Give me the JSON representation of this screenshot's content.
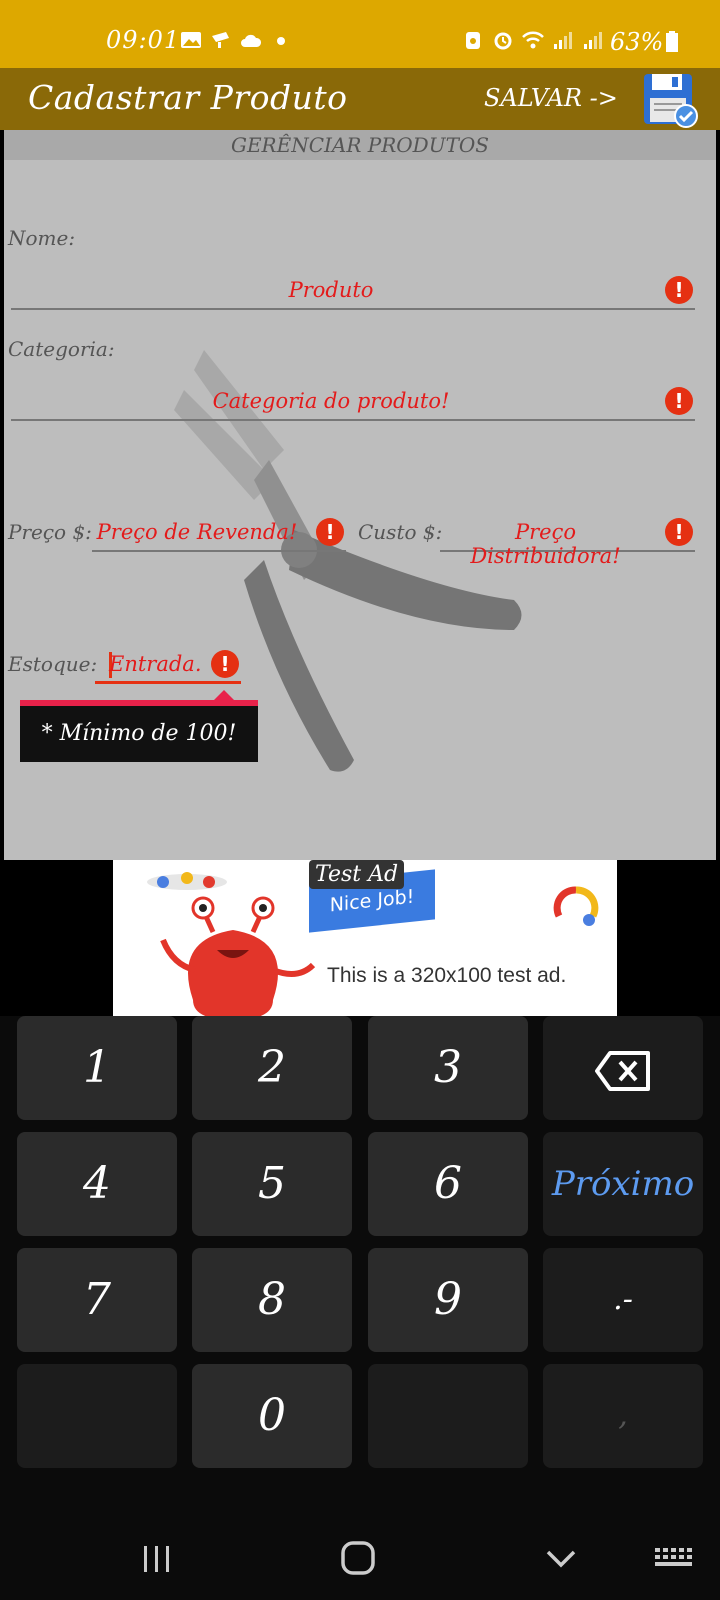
{
  "status_bar": {
    "time": "09:01",
    "battery": "63%"
  },
  "app_bar": {
    "title": "Cadastrar Produto",
    "save_label": "SALVAR ->"
  },
  "section": {
    "header": "GERÊNCIAR PRODUTOS"
  },
  "form": {
    "nome_label": "Nome:",
    "nome_placeholder": "Produto",
    "categoria_label": "Categoria:",
    "categoria_placeholder": "Categoria do produto!",
    "preco_label": "Preço $:",
    "preco_placeholder": "Preço de Revenda!",
    "custo_label": "Custo $:",
    "custo_placeholder": "Preço Distribuidora!",
    "estoque_label": "Estoque:",
    "estoque_placeholder": "Entrada.",
    "error_glyph": "!",
    "tooltip": "* Mínimo de 100!"
  },
  "ad": {
    "test_label": "Test Ad",
    "banner_text": "Nice Job!",
    "body_text": "This is a 320x100 test ad."
  },
  "keyboard": {
    "keys": [
      "1",
      "2",
      "3",
      "4",
      "5",
      "6",
      "7",
      "8",
      "9",
      "0"
    ],
    "next_label": "Próximo",
    "punct_label": ".-",
    "comma_label": ","
  },
  "colors": {
    "status_bar": "#DDA800",
    "app_bar": "#8A6908",
    "error": "#E53012",
    "placeholder_text": "#E31B1B",
    "next_key": "#5D9BF0"
  }
}
